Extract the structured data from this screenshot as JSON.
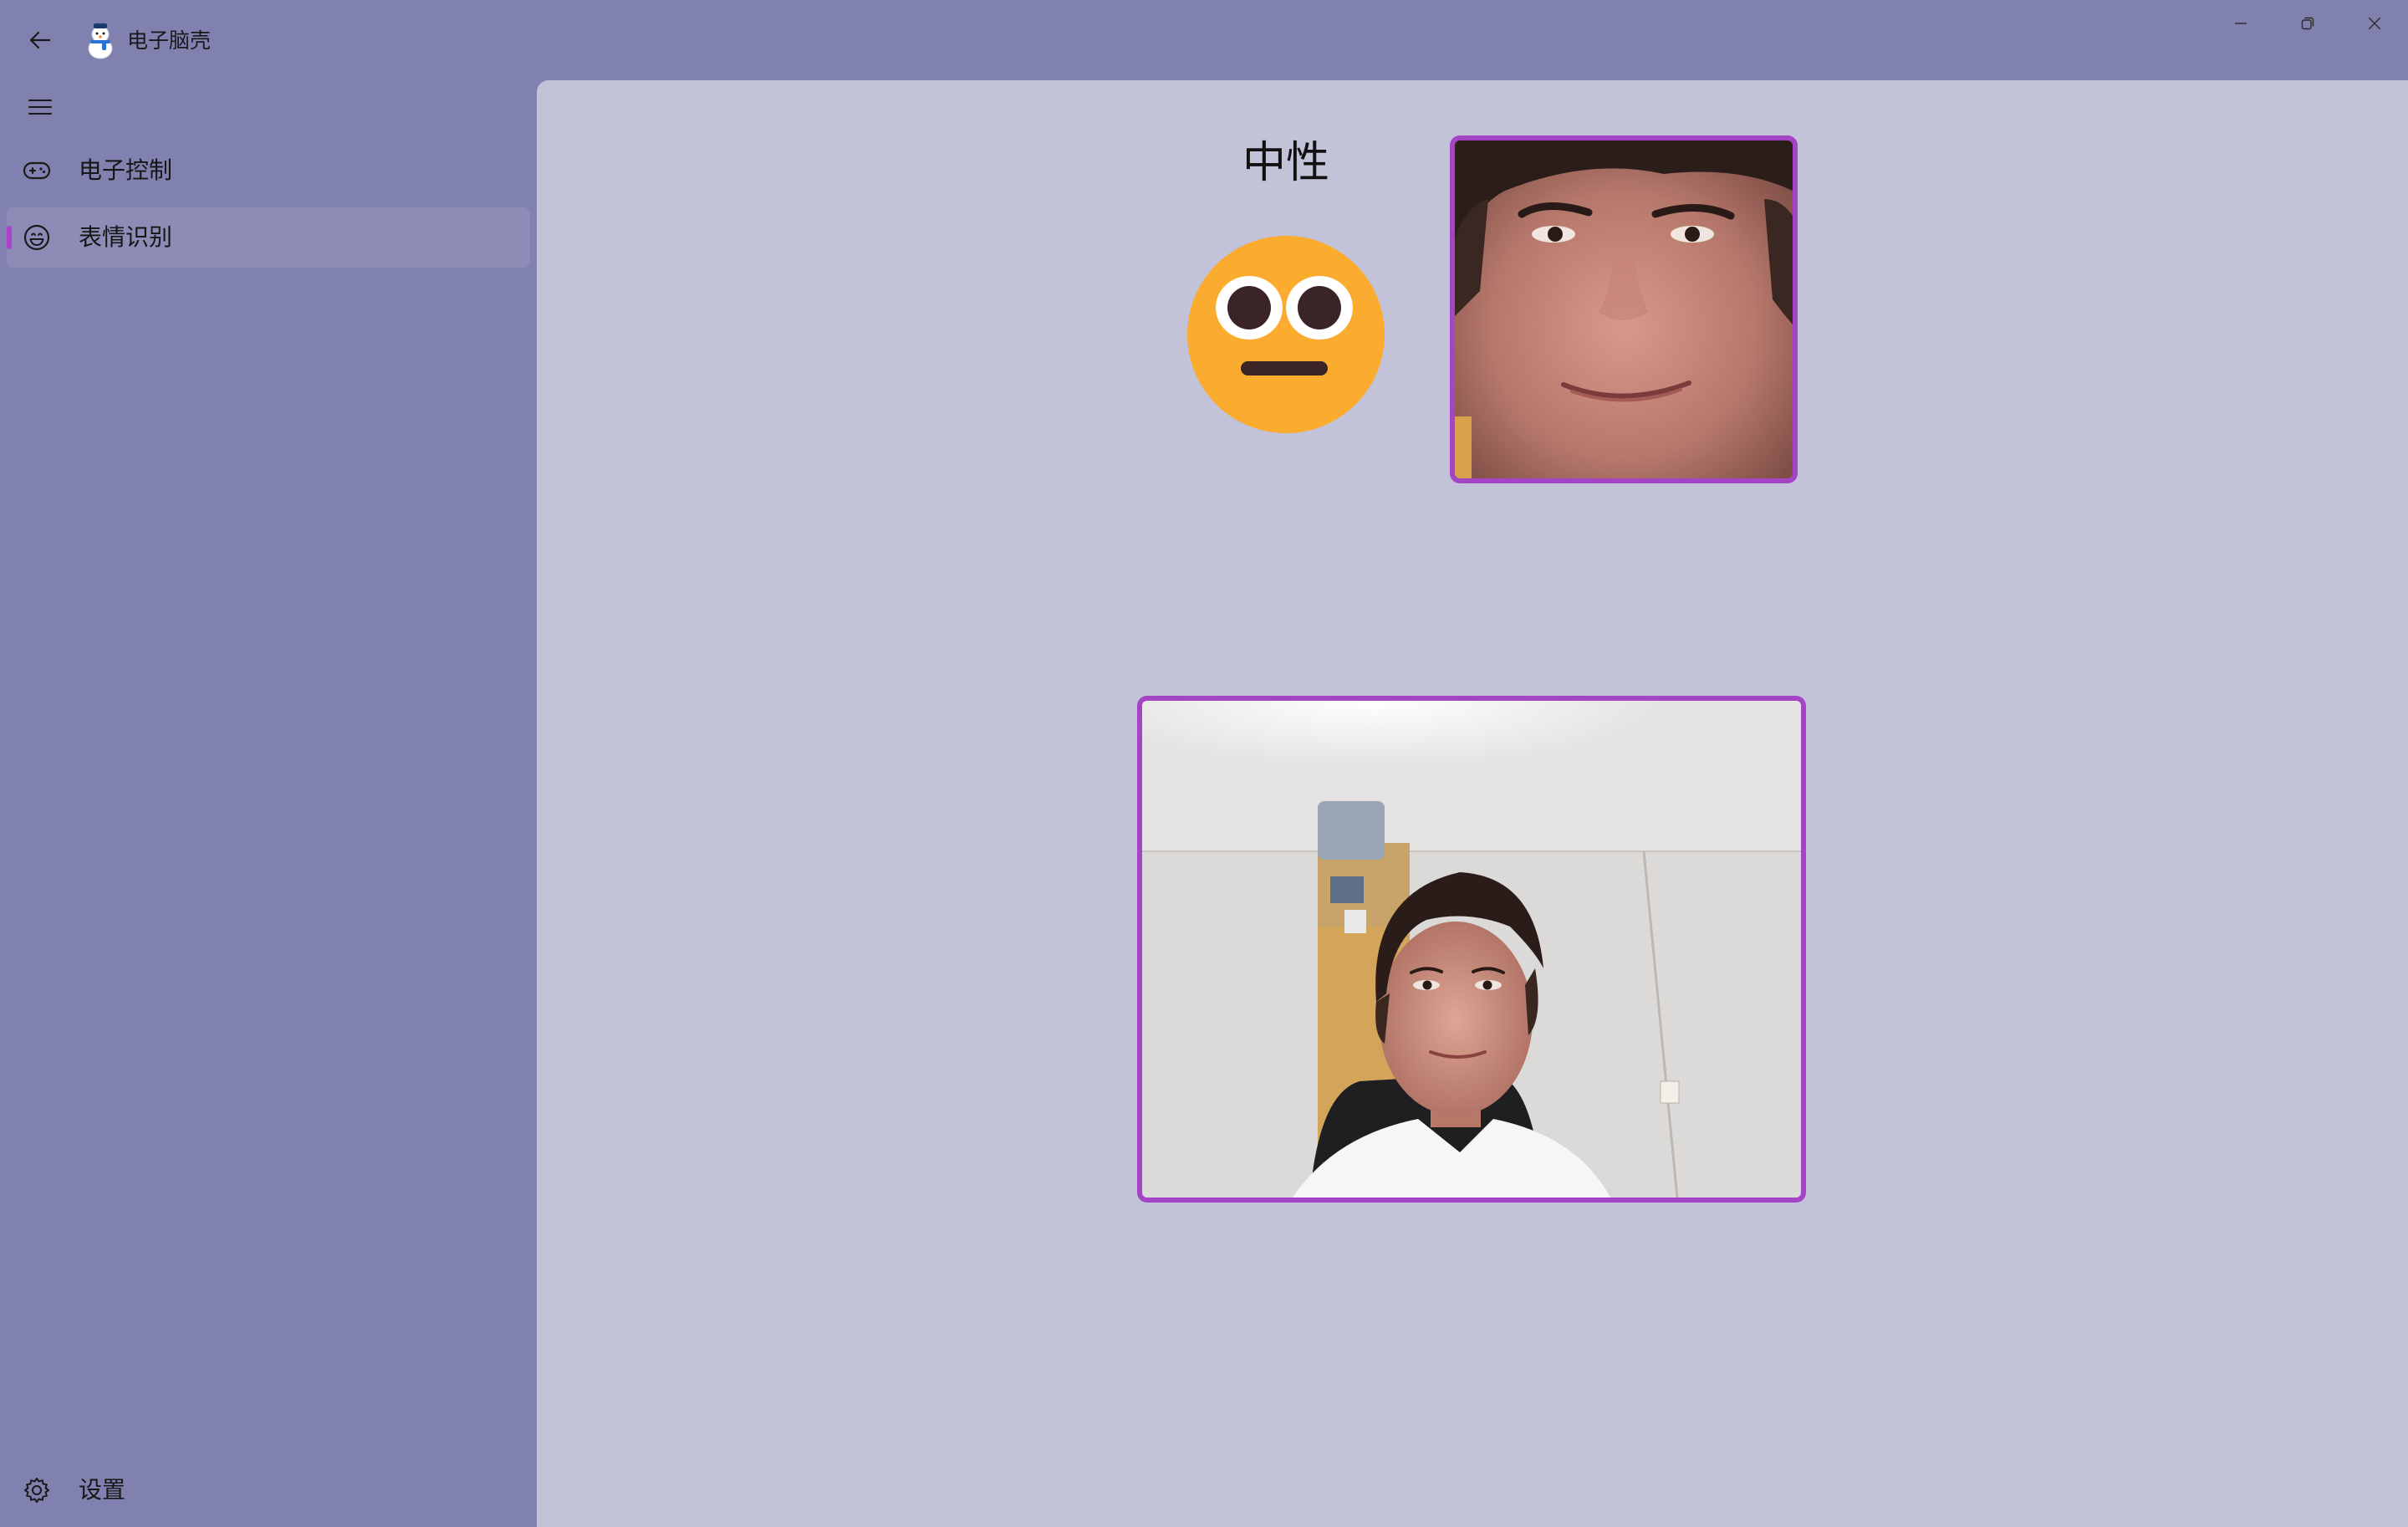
{
  "window": {
    "title": "电子脑壳"
  },
  "sidebar": {
    "items": [
      {
        "label": "电子控制",
        "icon": "gamepad-icon",
        "selected": false
      },
      {
        "label": "表情识别",
        "icon": "smiley-icon",
        "selected": true
      }
    ],
    "footer": {
      "label": "设置",
      "icon": "gear-icon"
    }
  },
  "main": {
    "emotion": "中性",
    "emoji": "neutral-face-emoji",
    "accent_color": "#a345c4"
  },
  "colors": {
    "sidebar_bg": "#8181b0",
    "content_bg": "#c2c2d9",
    "selected_indicator": "#b03fd0"
  }
}
